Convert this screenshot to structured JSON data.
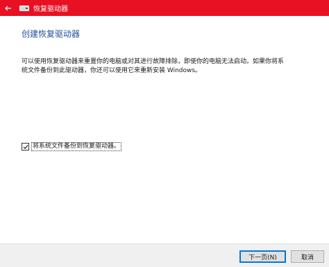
{
  "window": {
    "title": "恢复驱动器"
  },
  "main": {
    "heading": "创建恢复驱动器",
    "description": "可以使用恢复驱动器来重置你的电脑或对其进行故障排除，即使你的电脑无法启动。如果你将系统文件备份到此驱动器，你还可以使用它来重新安装 Windows。",
    "checkbox_label": "将系统文件备份到恢复驱动器。",
    "checkbox_checked": true
  },
  "footer": {
    "next_label": "下一页(N)",
    "cancel_label": "取消"
  },
  "colors": {
    "titlebar": "#e81123",
    "heading": "#1f4e9c",
    "accent": "#0078d7"
  }
}
